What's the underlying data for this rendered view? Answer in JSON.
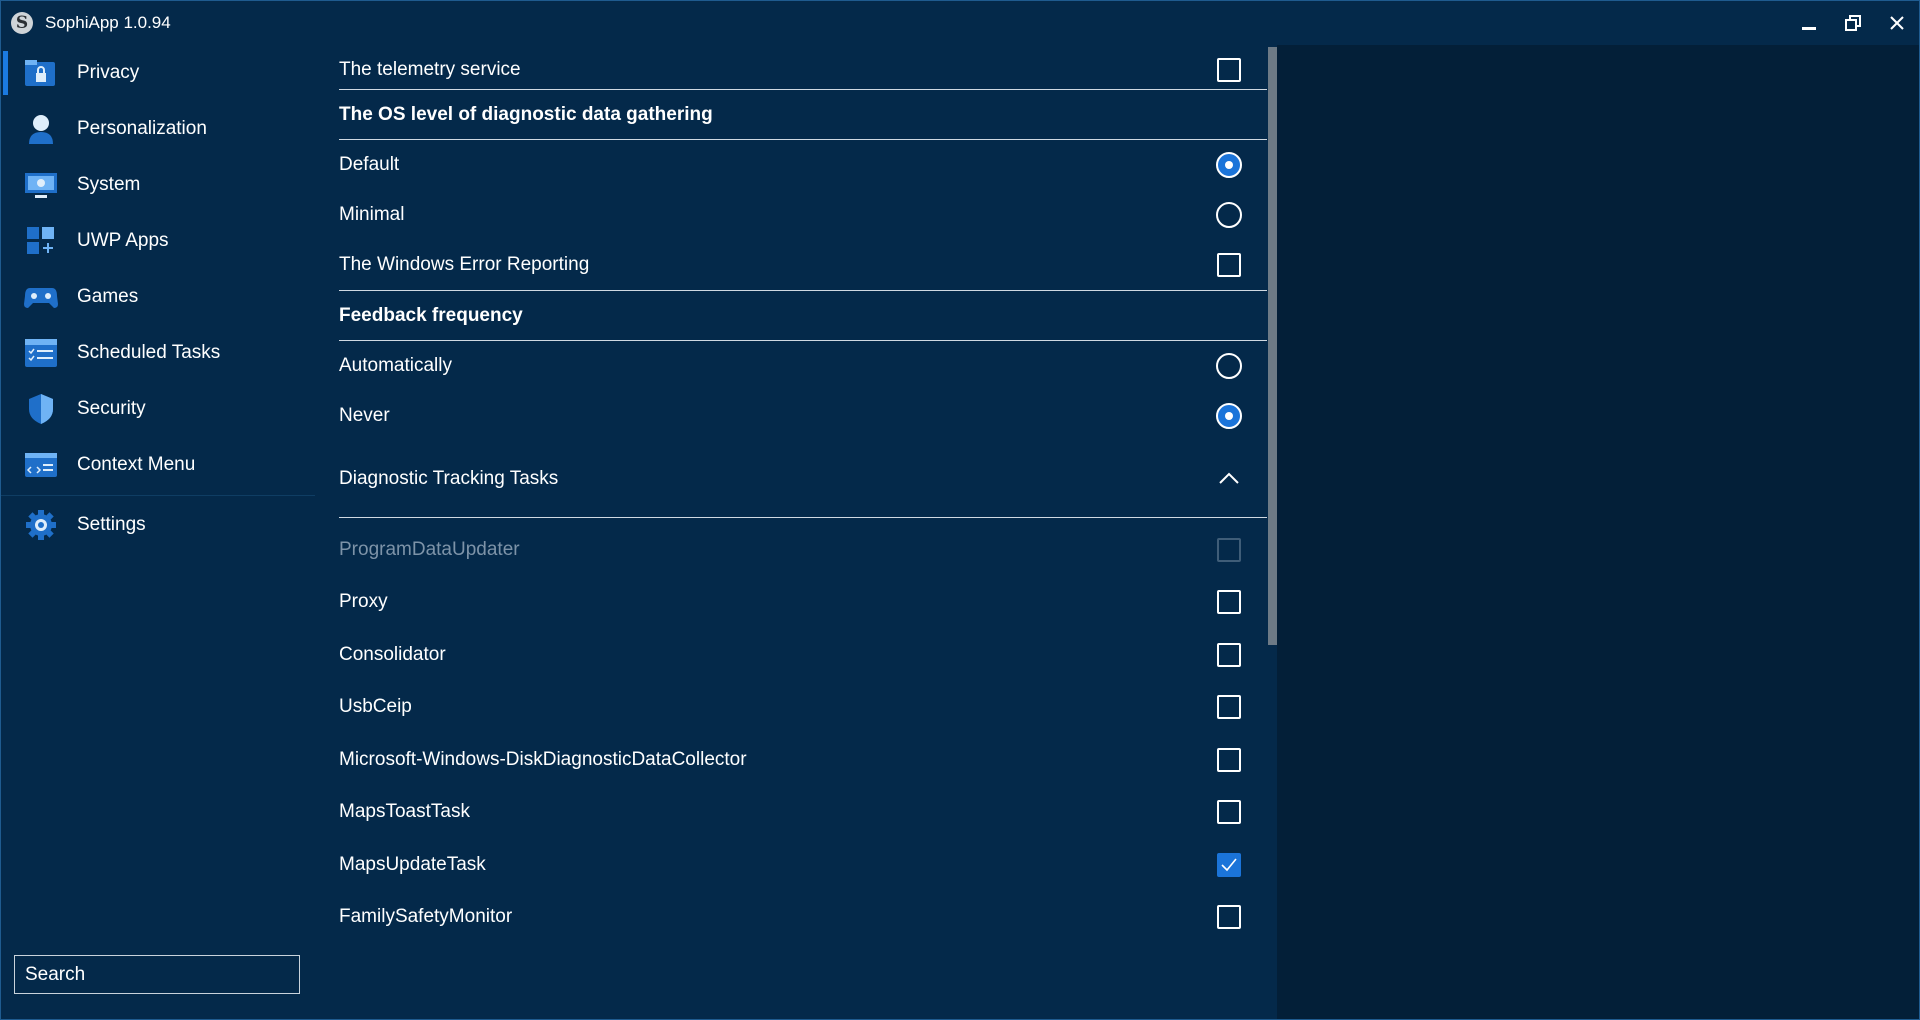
{
  "app": {
    "title": "SophiApp 1.0.94",
    "logo_letter": "S"
  },
  "window_controls": {
    "minimize": "minimize-icon",
    "restore": "restore-icon",
    "close": "close-icon"
  },
  "sidebar": {
    "items": [
      {
        "label": "Privacy",
        "icon": "lock-folder-icon",
        "active": true
      },
      {
        "label": "Personalization",
        "icon": "person-icon"
      },
      {
        "label": "System",
        "icon": "monitor-settings-icon"
      },
      {
        "label": "UWP Apps",
        "icon": "apps-grid-icon"
      },
      {
        "label": "Games",
        "icon": "gamepad-icon"
      },
      {
        "label": "Scheduled Tasks",
        "icon": "checklist-icon"
      },
      {
        "label": "Security",
        "icon": "shield-icon"
      },
      {
        "label": "Context Menu",
        "icon": "code-window-icon"
      },
      {
        "label": "Settings",
        "icon": "gear-icon"
      }
    ],
    "search": {
      "placeholder": "Search"
    }
  },
  "main": {
    "telemetry": {
      "label": "The telemetry service",
      "checked": false
    },
    "diag_header": "The OS level of diagnostic data gathering",
    "diag_options": [
      {
        "label": "Default",
        "checked": true
      },
      {
        "label": "Minimal",
        "checked": false
      }
    ],
    "error_reporting": {
      "label": "The Windows Error Reporting",
      "checked": false
    },
    "feedback_header": "Feedback frequency",
    "feedback_options": [
      {
        "label": "Automatically",
        "checked": false
      },
      {
        "label": "Never",
        "checked": true
      }
    ],
    "tracking_tasks": {
      "label": "Diagnostic Tracking Tasks",
      "expanded": true,
      "items": [
        {
          "label": "ProgramDataUpdater",
          "checked": false,
          "disabled": true
        },
        {
          "label": "Proxy",
          "checked": false
        },
        {
          "label": "Consolidator",
          "checked": false
        },
        {
          "label": "UsbCeip",
          "checked": false
        },
        {
          "label": "Microsoft-Windows-DiskDiagnosticDataCollector",
          "checked": false
        },
        {
          "label": "MapsToastTask",
          "checked": false
        },
        {
          "label": "MapsUpdateTask",
          "checked": true
        },
        {
          "label": "FamilySafetyMonitor",
          "checked": false
        }
      ]
    }
  },
  "colors": {
    "accent": "#1b74d9",
    "background": "#04294a",
    "right_pane": "#031f38"
  }
}
